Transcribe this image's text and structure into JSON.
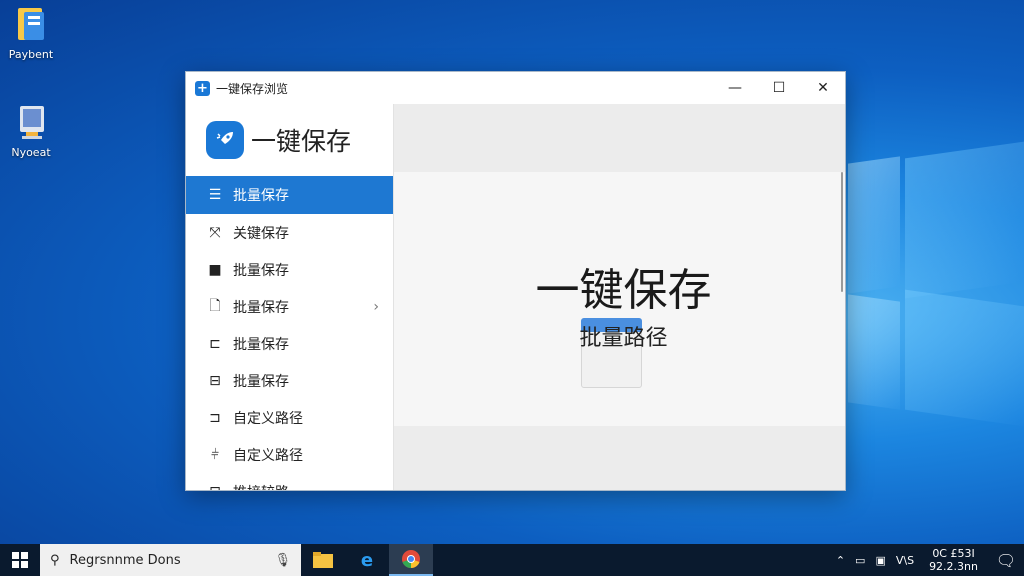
{
  "desktop": {
    "icons": [
      {
        "label": "Paybent"
      },
      {
        "label": "Nyoeat"
      }
    ]
  },
  "window": {
    "title": "一键保存浏览",
    "controls": {
      "minimize": "—",
      "maximize": "☐",
      "close": "✕"
    }
  },
  "sidebar": {
    "brand_title": "一键保存",
    "items": [
      {
        "label": "批量保存",
        "active": true
      },
      {
        "label": "关键保存"
      },
      {
        "label": "批量保存"
      },
      {
        "label": "批量保存",
        "has_submenu": true
      },
      {
        "label": "批量保存"
      },
      {
        "label": "批量保存"
      },
      {
        "label": "自定义路径"
      },
      {
        "label": "自定义路径"
      },
      {
        "label": "推接较路"
      }
    ]
  },
  "content": {
    "hero_title": "一键保存",
    "hero_subtitle": "批量路径"
  },
  "taskbar": {
    "search_placeholder": "Regrsnnme Dons",
    "clock_time": "0C £53I",
    "clock_date": "92.2.3nn",
    "tray_text": "V\\S"
  },
  "colors": {
    "accent": "#1e78d2",
    "desktop_blue": "#0d5fc1"
  }
}
